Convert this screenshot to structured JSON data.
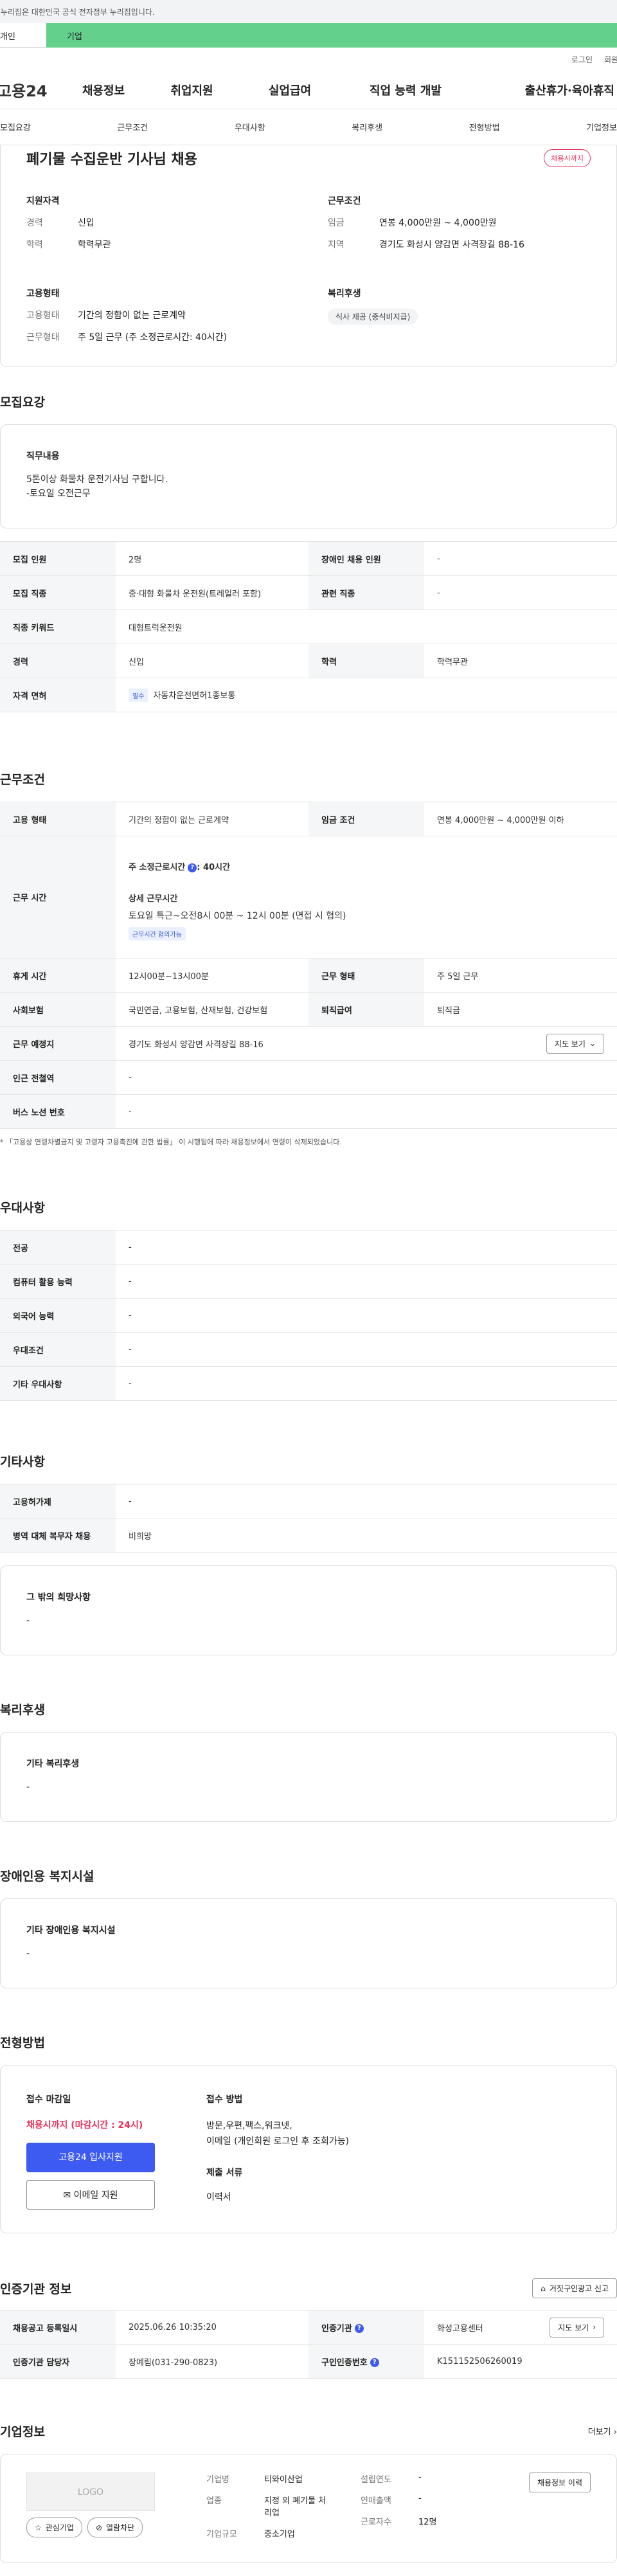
{
  "gov_banner": "이 누리집은 대한민국 공식 전자정부 누리집입니다.",
  "user_tabs": [
    "개인",
    "기업"
  ],
  "util_links": [
    "로그인",
    "회원가입"
  ],
  "logo": "고용24",
  "gnb": [
    "채용정보",
    "취업지원",
    "실업급여",
    "직업 능력 개발",
    "출산휴가·육아휴직"
  ],
  "subnav": [
    "모집요강",
    "근무조건",
    "우대사항",
    "복리후생",
    "전형방법",
    "기업정보"
  ],
  "summary": {
    "title": "폐기물 수집운반 기사님 채용",
    "deadline_badge": "채용시까지",
    "qual_title": "지원자격",
    "qual": [
      {
        "k": "경력",
        "v": "신입"
      },
      {
        "k": "학력",
        "v": "학력무관"
      }
    ],
    "cond_title": "근무조건",
    "cond": [
      {
        "k": "임금",
        "v": "연봉 4,000만원 ~ 4,000만원"
      },
      {
        "k": "지역",
        "v": "경기도 화성시 양감면 사격장길 88-16"
      }
    ],
    "emp_title": "고용형태",
    "emp": [
      {
        "k": "고용형태",
        "v": "기간의 정함이 없는 근로계약"
      },
      {
        "k": "근무형태",
        "v": "주 5일 근무 (주 소정근로시간: 40시간)"
      }
    ],
    "welfare_title": "복리후생",
    "welfare_chip": "식사 제공 (중식비지급)"
  },
  "recruit": {
    "section_title": "모집요강",
    "duty_title": "직무내용",
    "duty_lines": [
      "5톤이상 화물차 운전기사님 구합니다.",
      "-토요일 오전근무"
    ],
    "rows": [
      [
        "모집 인원",
        "2명",
        "장애인 채용 인원",
        "-"
      ],
      [
        "모집 직종",
        "중·대형 화물차 운전원(트레일러 포함)",
        "관련 직종",
        "-"
      ]
    ],
    "keyword_label": "직종 키워드",
    "keyword_value": "대형트럭운전원",
    "career_label": "경력",
    "career_value": "신입",
    "edu_label": "학력",
    "edu_value": "학력무관",
    "license_label": "자격 면허",
    "license_tag": "필수",
    "license_value": "자동차운전면허1종보통"
  },
  "conditions": {
    "section_title": "근무조건",
    "emp_type_label": "고용 형태",
    "emp_type_value": "기간의 정함이 없는 근로계약",
    "wage_label": "임금 조건",
    "wage_value": "연봉 4,000만원 ~ 4,000만원 이하",
    "hours_label": "근무 시간",
    "weekly_hours": "주 소정근로시간",
    "weekly_hours_value": ": 40시간",
    "detail_title": "상세 근무시간",
    "detail_value": "토요일 특근~오전8시 00분 ~ 12시 00분 (면접 시 협의)",
    "detail_tag": "근무시간 협의가능",
    "break_label": "휴게 시간",
    "break_value": "12시00분~13시00분",
    "work_type_label": "근무 형태",
    "work_type_value": "주 5일 근무",
    "insurance_label": "사회보험",
    "insurance_value": "국민연금, 고용보험, 산재보험, 건강보험",
    "retire_label": "퇴직급여",
    "retire_value": "퇴직금",
    "place_label": "근무 예정지",
    "place_value": "경기도 화성시 양감면 사격장길 88-16",
    "map_button": "지도 보기",
    "subway_label": "인근 전철역",
    "subway_value": "-",
    "bus_label": "버스 노선 번호",
    "bus_value": "-",
    "disclaimer": "「고용상 연령차별금지 및 고령자 고용촉진에 관한 법률」 이 시행됨에 따라 채용정보에서 연령이 삭제되었습니다."
  },
  "preference": {
    "section_title": "우대사항",
    "rows": [
      [
        "전공",
        "-"
      ],
      [
        "컴퓨터 활용 능력",
        "-"
      ],
      [
        "외국어 능력",
        "-"
      ],
      [
        "우대조건",
        "-"
      ],
      [
        "기타 우대사항",
        "-"
      ]
    ]
  },
  "other": {
    "section_title": "기타사항",
    "rows": [
      [
        "고용허가제",
        "-"
      ],
      [
        "병역 대체 복무자 채용",
        "비희망"
      ]
    ],
    "note_title": "그 밖의 희망사항",
    "note_value": "-"
  },
  "welfare": {
    "section_title": "복리후생",
    "note_title": "기타 복리후생",
    "note_value": "-"
  },
  "disability": {
    "section_title": "장애인용 복지시설",
    "note_title": "기타 장애인용 복지시설",
    "note_value": "-"
  },
  "selection": {
    "section_title": "전형방법",
    "deadline_title": "접수 마감일",
    "deadline_value": "채용시까지 (마감시간 : 24시)",
    "apply_button": "고용24 입사지원",
    "email_button": "이메일 지원",
    "method_title": "접수 방법",
    "method_lines": [
      "방문,우편,팩스,워크넷,",
      "이메일 (개인회원 로그인 후 조회가능)"
    ],
    "docs_title": "제출 서류",
    "docs_value": "이력서"
  },
  "agency": {
    "section_title": "인증기관 정보",
    "report_button": "거짓구인광고 신고",
    "reg_label": "채용공고 등록일시",
    "reg_value": "2025.06.26 10:35:20",
    "org_label": "인증기관",
    "org_value": "화성고용센터",
    "map_button": "지도 보기",
    "manager_label": "인증기관 담당자",
    "manager_value": "장예림(031-290-0823)",
    "job_no_label": "구인인증번호",
    "job_no_value": "K151152506260019"
  },
  "company": {
    "section_title": "기업정보",
    "more": "더보기",
    "logo_placeholder": "LOGO",
    "fav_button": "관심기업",
    "block_button": "열람차단",
    "name_label": "기업명",
    "name_value": "티와이산업",
    "industry_label": "업종",
    "industry_lines": [
      "지정 외 폐기물 처",
      "리업"
    ],
    "size_label": "기업규모",
    "size_value": "중소기업",
    "founded_label": "설립연도",
    "founded_value": "-",
    "revenue_label": "연매출액",
    "revenue_value": "-",
    "employees_label": "근로자수",
    "employees_value": "12명",
    "history_button": "채용정보 이력"
  }
}
